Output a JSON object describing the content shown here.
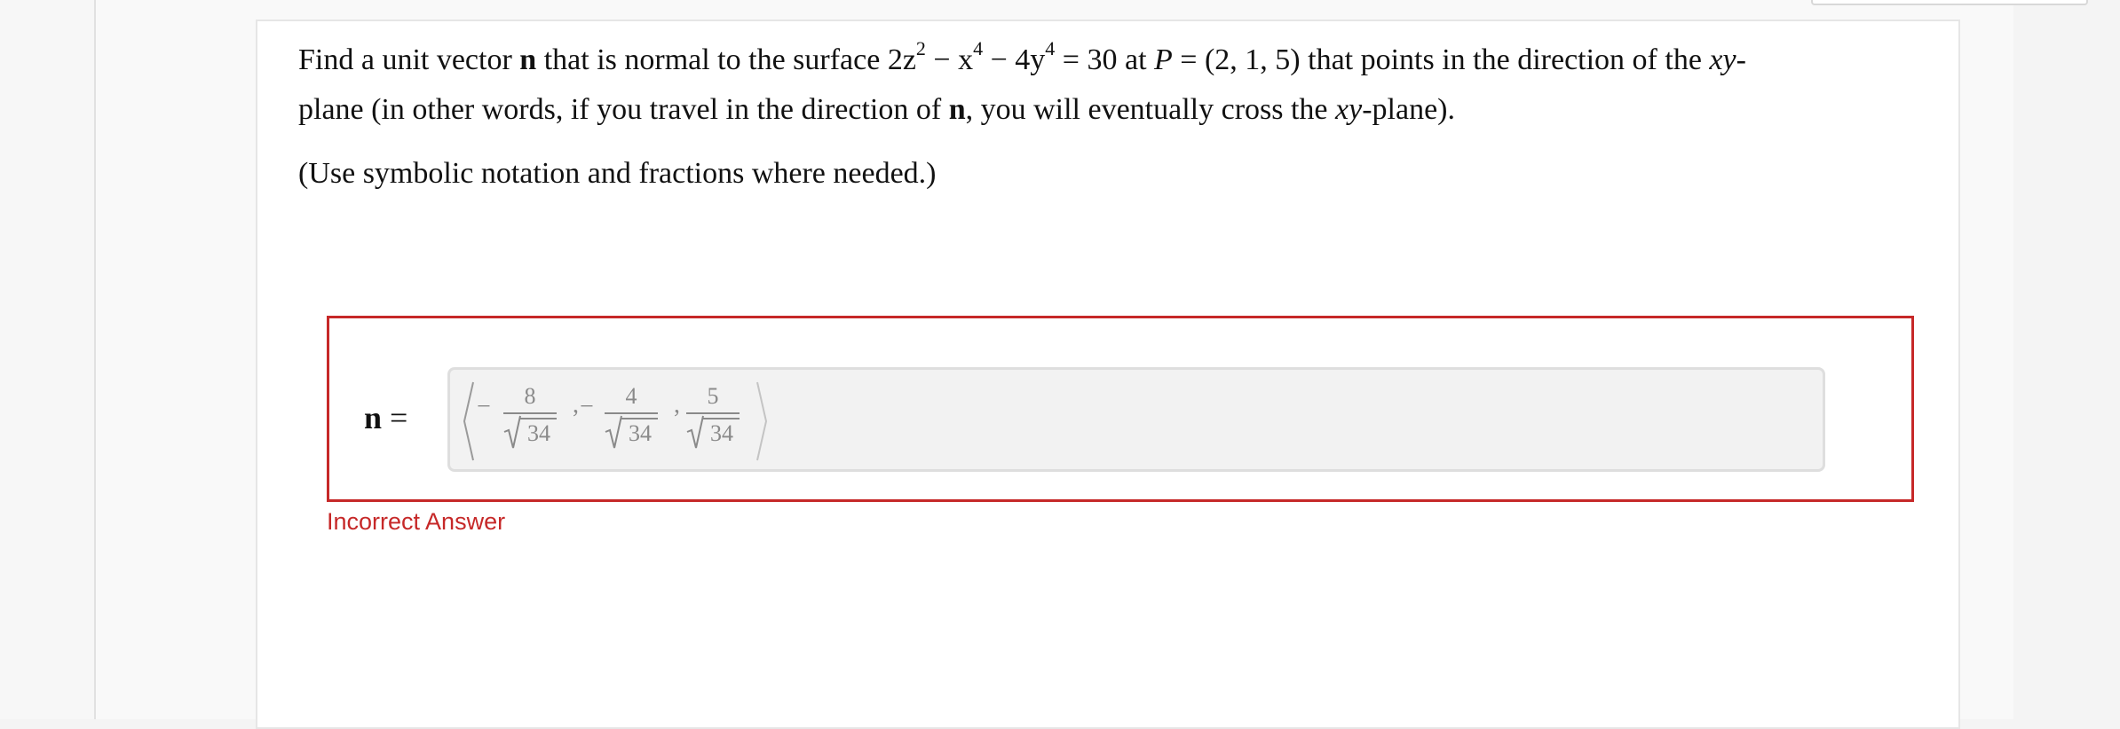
{
  "question": {
    "line1_parts": [
      "Find a unit vector ",
      "n",
      " that is normal to the surface 2z",
      "2",
      " − x",
      "4",
      " − 4y",
      "4",
      " = 30 at ",
      "P",
      " = (2, 1, 5) that points in the direction of the ",
      "xy",
      "-"
    ],
    "line2_parts": [
      "plane (in other words, if you travel in the direction of ",
      "n",
      ", you will eventually cross the ",
      "xy",
      "-plane)."
    ],
    "note": "(Use symbolic notation and fractions where needed.)"
  },
  "answer": {
    "label_var": "n",
    "label_eq": " =",
    "components": [
      {
        "sign": "−",
        "numerator": "8",
        "denominator": "34"
      },
      {
        "sign": "−",
        "numerator": "4",
        "denominator": "34"
      },
      {
        "sign": "",
        "numerator": "5",
        "denominator": "34"
      }
    ],
    "separator": ","
  },
  "feedback": "Incorrect Answer",
  "colors": {
    "error": "#c62828",
    "field_bg": "#f2f2f2",
    "field_text": "#8a8a8a"
  }
}
